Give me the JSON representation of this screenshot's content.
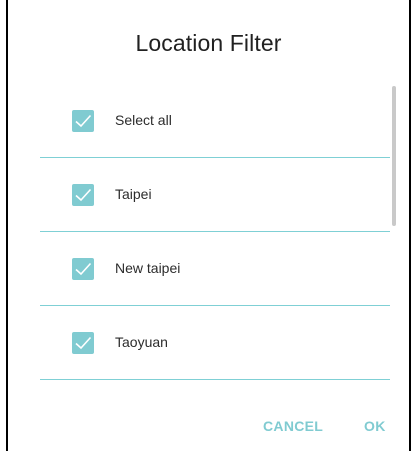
{
  "dialog": {
    "title": "Location Filter",
    "items": [
      {
        "label": "Select all",
        "checked": true
      },
      {
        "label": "Taipei",
        "checked": true
      },
      {
        "label": "New taipei",
        "checked": true
      },
      {
        "label": "Taoyuan",
        "checked": true
      }
    ],
    "cancel_label": "CANCEL",
    "ok_label": "OK"
  },
  "colors": {
    "accent": "#80cbd1",
    "divider": "#7fd0d5",
    "title_text": "#212121",
    "label_text": "#2c2c2c"
  },
  "icons": [
    "check-icon"
  ]
}
